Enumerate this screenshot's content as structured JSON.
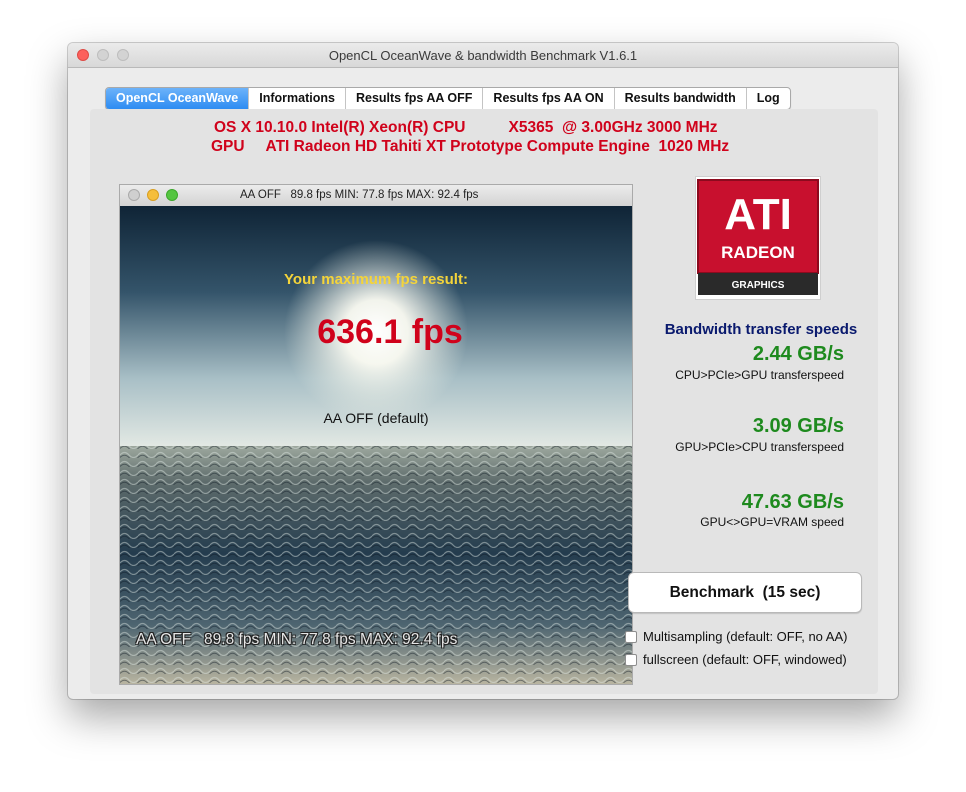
{
  "window": {
    "title": "OpenCL OceanWave & bandwidth Benchmark V1.6.1"
  },
  "tabs": [
    {
      "label": "OpenCL OceanWave",
      "active": true
    },
    {
      "label": "Informations",
      "active": false
    },
    {
      "label": "Results fps AA OFF",
      "active": false
    },
    {
      "label": "Results fps AA ON",
      "active": false
    },
    {
      "label": "Results bandwidth",
      "active": false
    },
    {
      "label": "Log",
      "active": false
    }
  ],
  "system_info": {
    "line1": "OS X 10.10.0 Intel(R) Xeon(R) CPU          X5365  @ 3.00GHz 3000 MHz",
    "line2": "GPU     ATI Radeon HD Tahiti XT Prototype Compute Engine  1020 MHz"
  },
  "render_window": {
    "title": "AA OFF   89.8 fps MIN: 77.8 fps MAX: 92.4 fps",
    "max_label": "Your maximum fps result:",
    "max_fps": "636.1 fps",
    "aa_mode": "AA OFF (default)",
    "status_overlay": "AA OFF   89.8 fps MIN: 77.8 fps MAX: 92.4 fps"
  },
  "logo": {
    "brand": "ATI",
    "product": "RADEON",
    "sub": "GRAPHICS"
  },
  "bandwidth": {
    "title": "Bandwidth transfer speeds",
    "items": [
      {
        "value": "2.44 GB/s",
        "label": "CPU>PCIe>GPU transferspeed"
      },
      {
        "value": "3.09 GB/s",
        "label": "GPU>PCIe>CPU transferspeed"
      },
      {
        "value": "47.63 GB/s",
        "label": "GPU<>GPU=VRAM speed"
      }
    ]
  },
  "benchmark_button": "Benchmark  (15 sec)",
  "options": [
    {
      "label": "Multisampling (default: OFF, no AA)",
      "checked": false
    },
    {
      "label": "fullscreen (default: OFF, windowed)",
      "checked": false
    }
  ],
  "colors": {
    "accent_tab": "#2d8cf2",
    "system_text": "#d0021b",
    "fps_value": "#d0021b",
    "max_label": "#f4d43a",
    "bandwidth_title": "#0a1a6e",
    "bandwidth_value": "#1e8a1e",
    "logo_red": "#c8102e"
  }
}
